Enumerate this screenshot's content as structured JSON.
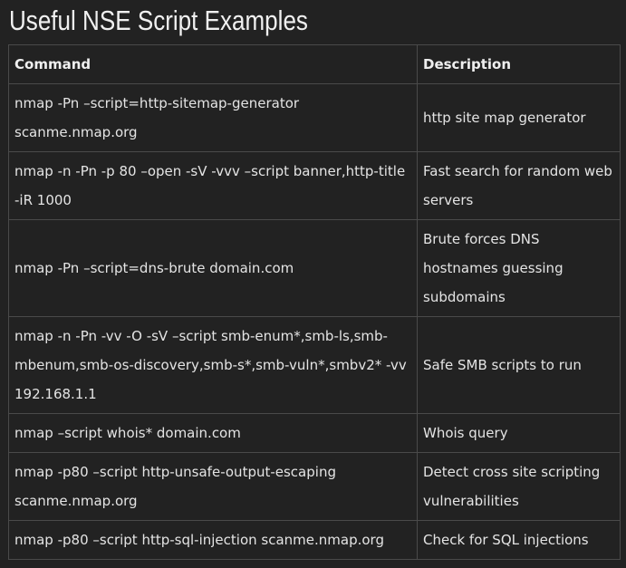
{
  "heading": "Useful NSE Script Examples",
  "table": {
    "headers": [
      "Command",
      "Description"
    ],
    "rows": [
      {
        "command": "nmap -Pn –script=http-sitemap-generator scanme.nmap.org",
        "description": "http site map generator"
      },
      {
        "command": "nmap -n -Pn -p 80 –open -sV -vvv –script banner,http-title -iR 1000",
        "description": "Fast search for random web servers"
      },
      {
        "command": "nmap -Pn –script=dns-brute domain.com",
        "description": "Brute forces DNS hostnames guessing subdomains"
      },
      {
        "command": "nmap -n -Pn -vv -O -sV –script smb-enum*,smb-ls,smb-mbenum,smb-os-discovery,smb-s*,smb-vuln*,smbv2* -vv 192.168.1.1",
        "description": "Safe SMB scripts to run"
      },
      {
        "command": "nmap –script whois* domain.com",
        "description": "Whois query"
      },
      {
        "command": "nmap -p80 –script http-unsafe-output-escaping scanme.nmap.org",
        "description": "Detect cross site scripting vulnerabilities"
      },
      {
        "command": "nmap -p80 –script http-sql-injection scanme.nmap.org",
        "description": "Check for SQL injections"
      }
    ]
  }
}
